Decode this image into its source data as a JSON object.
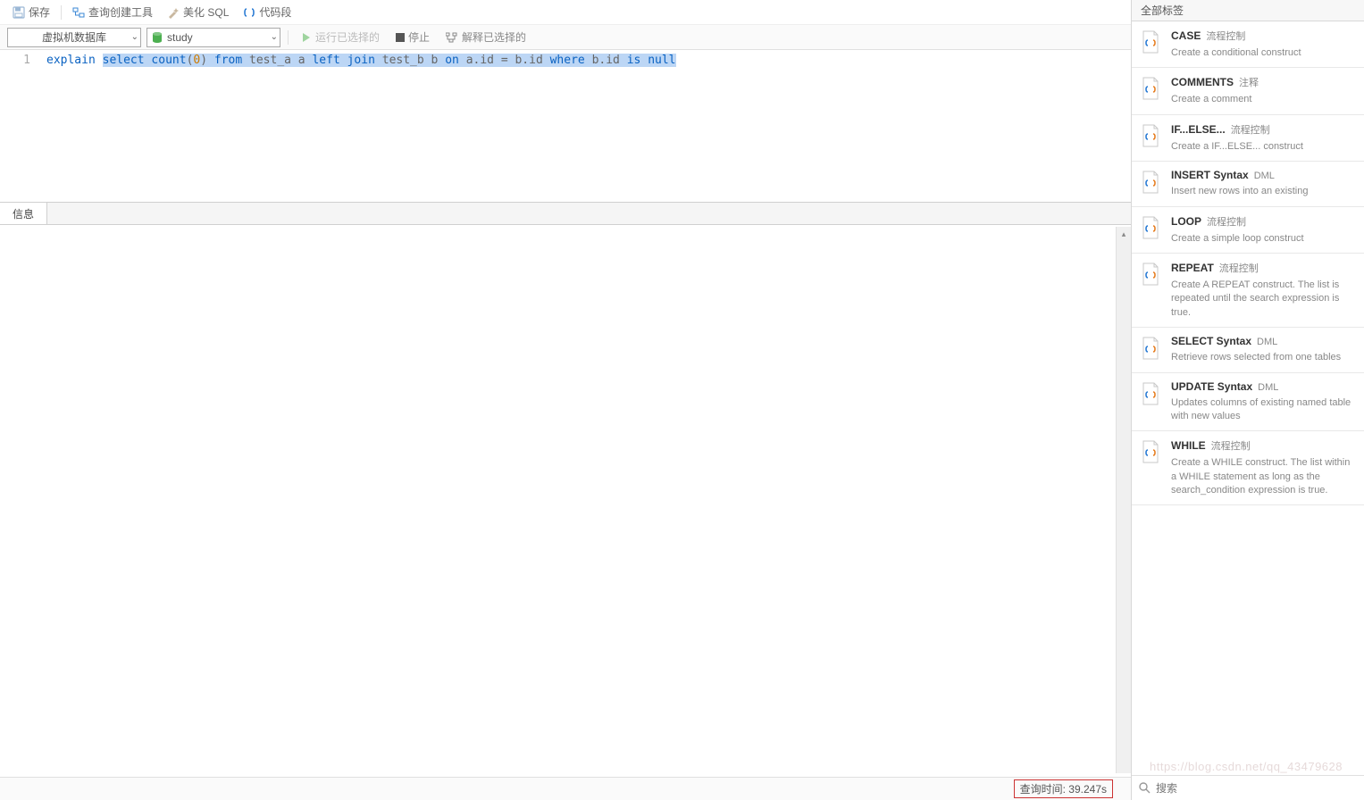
{
  "toolbar": {
    "save": "保存",
    "queryBuilder": "查询创建工具",
    "beautify": "美化 SQL",
    "snippet": "代码段"
  },
  "secondBar": {
    "connection": "虚拟机数据库",
    "database": "study",
    "run": "运行已选择的",
    "stop": "停止",
    "explain": "解释已选择的"
  },
  "editor": {
    "lineNo": "1",
    "tokens": {
      "explain": "explain",
      "select": "select",
      "count": "count",
      "lp": "(",
      "zero": "0",
      "rp": ")",
      "from": "from",
      "ta": "test_a a",
      "left": "left",
      "join": "join",
      "tb": "test_b b",
      "on": "on",
      "cond": "a.id = b.id",
      "where": "where",
      "bid": "b.id",
      "is": "is",
      "null": "null"
    }
  },
  "resultTab": "信息",
  "status": {
    "label": "查询时间:",
    "value": "39.247s"
  },
  "side": {
    "header": "全部标签",
    "searchPlaceholder": "搜索",
    "items": [
      {
        "title": "CASE",
        "tag": "流程控制",
        "desc": "Create a conditional construct"
      },
      {
        "title": "COMMENTS",
        "tag": "注释",
        "desc": "Create a comment"
      },
      {
        "title": "IF...ELSE...",
        "tag": "流程控制",
        "desc": "Create a IF...ELSE... construct"
      },
      {
        "title": "INSERT Syntax",
        "tag": "DML",
        "desc": "Insert new rows into an existing"
      },
      {
        "title": "LOOP",
        "tag": "流程控制",
        "desc": "Create a simple loop construct"
      },
      {
        "title": "REPEAT",
        "tag": "流程控制",
        "desc": "Create A REPEAT construct. The list is repeated until the search expression is true."
      },
      {
        "title": "SELECT Syntax",
        "tag": "DML",
        "desc": "Retrieve rows selected from one tables"
      },
      {
        "title": "UPDATE Syntax",
        "tag": "DML",
        "desc": "Updates columns of existing named table with new values"
      },
      {
        "title": "WHILE",
        "tag": "流程控制",
        "desc": "Create a WHILE construct. The list within a WHILE statement as long as the search_condition expression is true."
      }
    ]
  },
  "watermark": "https://blog.csdn.net/qq_43479628"
}
